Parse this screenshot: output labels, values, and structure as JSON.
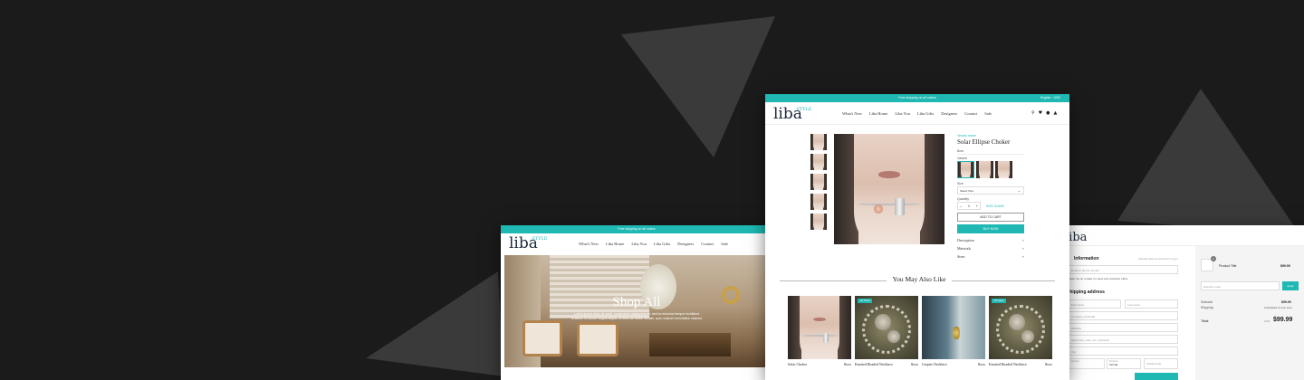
{
  "win_left": {
    "topbar": "Free shipping on all orders",
    "logo_main": "liba",
    "logo_sub": "STYLE",
    "nav": [
      "What's New",
      "Liba Home",
      "Liba You",
      "Liba Gifts",
      "Designers",
      "Contact",
      "Sale"
    ],
    "hero_title": "Shop All",
    "hero_text_1": "Lorem ipsum dolor sit amet, consectetur adipiscing elit, sed do eiusmod tempor incididunt",
    "hero_text_2": "ut labore et dolore magna aliqua. Ut enim ad minim veniam, quis nostrud exercitation ullamco"
  },
  "win_product": {
    "topbar": "Free shipping on all orders",
    "language": "English · USD",
    "logo_main": "liba",
    "logo_sub": "STYLE",
    "nav": [
      "What's New",
      "Liba Home",
      "Liba You",
      "Liba Gifts",
      "Designers",
      "Contact",
      "Sale"
    ],
    "brand": "Vendor name",
    "title": "Solar Ellipse Choker",
    "price": "$xxx",
    "variant_label": "Variant",
    "size_label": "Size",
    "size_value": "Select Size",
    "quantity_label": "Quantity",
    "quantity_value": "1",
    "size_guide": "SIZE GUIDE",
    "add_to_cart": "ADD TO CART",
    "buy_now": "BUY NOW",
    "accordions": [
      "Description",
      "Materials",
      "Sizes"
    ],
    "related_title": "You May Also Like",
    "products": [
      {
        "name": "Solar Choker",
        "price": "$xxx",
        "badge": ""
      },
      {
        "name": "Knotted Beaded Necklace",
        "price": "$xxx",
        "badge": "ON SALE"
      },
      {
        "name": "Carpter Necklace",
        "price": "$xxx",
        "badge": ""
      },
      {
        "name": "Knotted Beaded Necklace",
        "price": "$xxx",
        "badge": "ON SALE"
      }
    ]
  },
  "win_checkout": {
    "logo_main": "liba",
    "contact_heading": "Information",
    "have_account": "Already have an account? Log in",
    "email_placeholder": "Email or phone number",
    "newsletter": "Keep me up to date on news and exclusive offers",
    "shipping_heading": "Shipping address",
    "first_name": "First name",
    "last_name": "Last name",
    "company": "Company (optional)",
    "address": "Address",
    "apartment": "Apartment, suite, etc. (optional)",
    "city": "City",
    "country_label": "Country",
    "country_value": "Canada",
    "province_label": "Province",
    "province_value": "Florida",
    "postal": "Postal Code",
    "item_qty": "1",
    "item_title": "Product Title",
    "item_price": "$99.99",
    "discount_placeholder": "Discount code",
    "apply": "Apply",
    "subtotal_label": "Subtotal",
    "subtotal_value": "$99.99",
    "shipping_label": "Shipping",
    "shipping_value": "Calculated at next step",
    "total_label": "Total",
    "currency": "CAD",
    "total_value": "$99.99"
  },
  "colors": {
    "accent": "#1fb8b3",
    "background": "#1b1b1b",
    "triangle": "#3a3a3a"
  }
}
